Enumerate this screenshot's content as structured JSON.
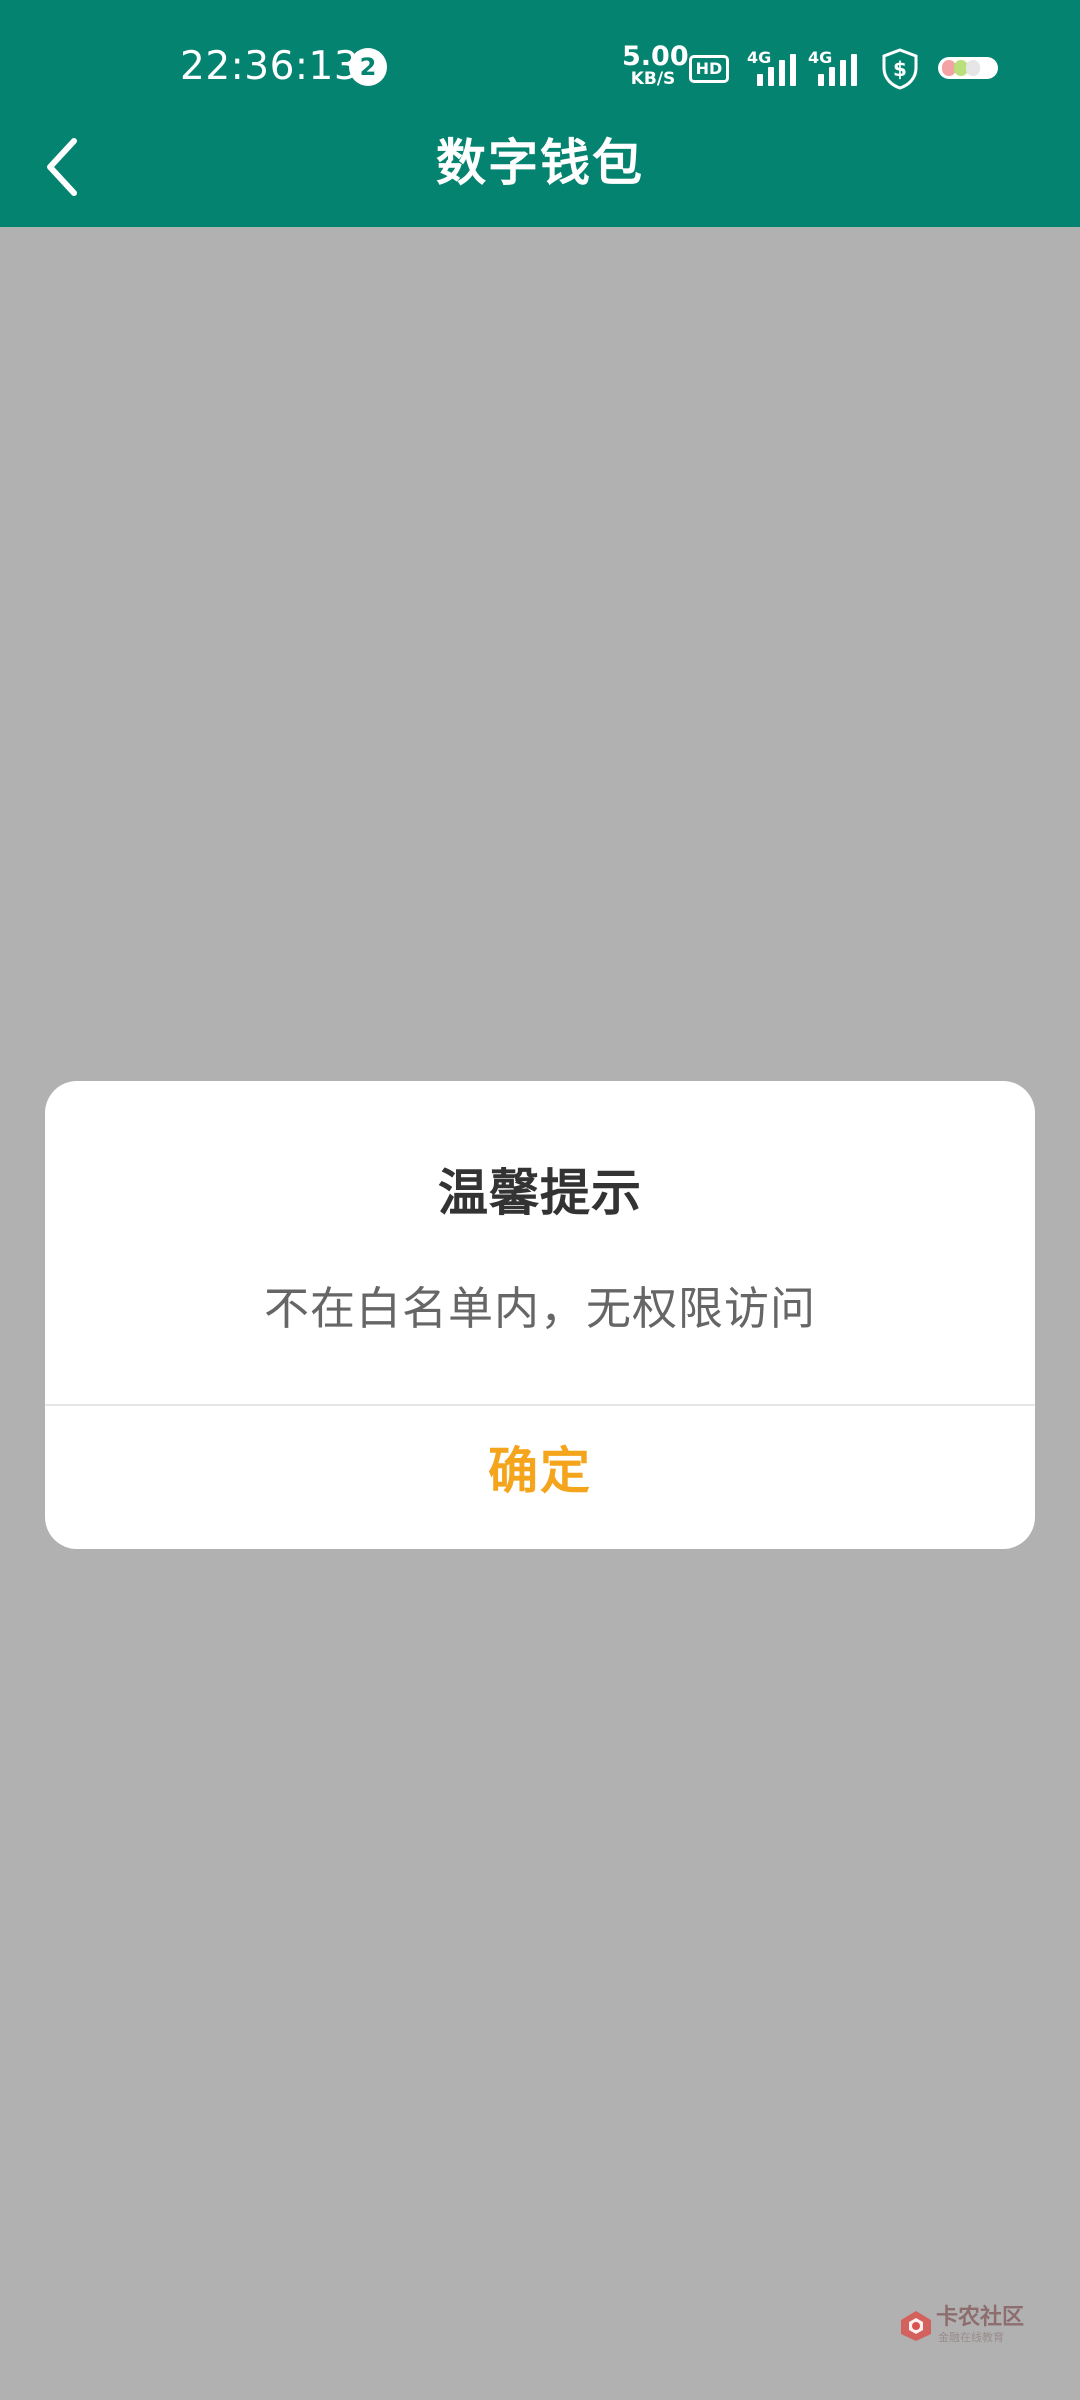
{
  "status_bar": {
    "time": "22:36:13",
    "notification_count": "2",
    "net_speed_value": "5.00",
    "net_speed_unit": "KB/S",
    "hd_label": "HD",
    "signal1_label": "4G",
    "signal2_label": "4G",
    "icons": [
      "hd-icon",
      "signal-4g-icon",
      "signal-4g-icon",
      "shield-dollar-icon",
      "battery-icon"
    ]
  },
  "header": {
    "title": "数字钱包",
    "back_icon": "chevron-left-icon"
  },
  "dialog": {
    "title": "温馨提示",
    "message": "不在白名单内，无权限访问",
    "ok_label": "确定"
  },
  "watermark": {
    "text": "卡农社区",
    "subtext": "金融在线教育"
  },
  "colors": {
    "header_bg": "#058371",
    "overlay_bg": "#b1b1b1",
    "dialog_bg": "#ffffff",
    "title_text": "#333333",
    "message_text": "#666666",
    "ok_text": "#f4a51c",
    "divider": "#e6e6e6"
  }
}
